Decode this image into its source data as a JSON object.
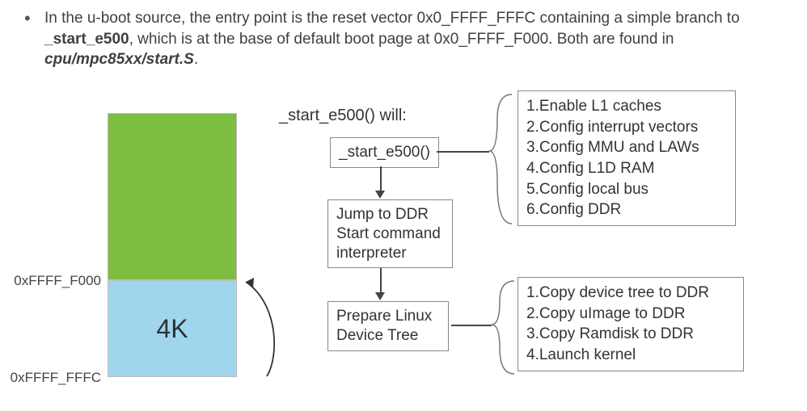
{
  "bullet": {
    "prefix": "In the u-boot source, the entry point is the reset vector 0x0_FFFF_FFFC containing a simple branch to ",
    "sym": "_start_e500",
    "mid": ", which is at the base of default boot page at 0x0_FFFF_F000. Both are found in ",
    "file": "cpu/mpc85xx/start.S",
    "suffix": "."
  },
  "memory": {
    "addr_top": "0xFFFF_F000",
    "addr_bot": "0xFFFF_FFFC",
    "size_label": "4K"
  },
  "flow": {
    "title": "_start_e500() will:",
    "n1": "_start_e500()",
    "n2_l1": "Jump to DDR",
    "n2_l2": "Start command",
    "n2_l3": "interpreter",
    "n3_l1": "Prepare Linux",
    "n3_l2": "Device Tree"
  },
  "start_steps": {
    "s1": "1.Enable L1 caches",
    "s2": "2.Config interrupt vectors",
    "s3": "3.Config MMU and LAWs",
    "s4": "4.Config L1D RAM",
    "s5": "5.Config local bus",
    "s6": "6.Config DDR"
  },
  "prepare_steps": {
    "p1": "1.Copy device tree to DDR",
    "p2": "2.Copy uImage  to DDR",
    "p3": "3.Copy Ramdisk to DDR",
    "p4": "4.Launch kernel"
  },
  "chart_data": {
    "type": "diagram",
    "memory_layout": {
      "boot_page_base": "0x0_FFFF_F000",
      "reset_vector": "0x0_FFFF_FFFC",
      "boot_page_size": "4K"
    },
    "flow_nodes": [
      {
        "id": "start_e500",
        "label": "_start_e500()"
      },
      {
        "id": "jump_ddr",
        "label": "Jump to DDR / Start command interpreter"
      },
      {
        "id": "prepare_dtb",
        "label": "Prepare Linux Device Tree"
      }
    ],
    "flow_edges": [
      {
        "from": "reset_vector",
        "to": "start_e500",
        "kind": "branch"
      },
      {
        "from": "start_e500",
        "to": "jump_ddr",
        "kind": "sequence"
      },
      {
        "from": "jump_ddr",
        "to": "prepare_dtb",
        "kind": "sequence"
      }
    ],
    "start_e500_actions": [
      "Enable L1 caches",
      "Config interrupt vectors",
      "Config MMU and LAWs",
      "Config L1D RAM",
      "Config local bus",
      "Config DDR"
    ],
    "prepare_linux_actions": [
      "Copy device tree to DDR",
      "Copy uImage to DDR",
      "Copy Ramdisk to DDR",
      "Launch kernel"
    ],
    "source_file": "cpu/mpc85xx/start.S"
  }
}
